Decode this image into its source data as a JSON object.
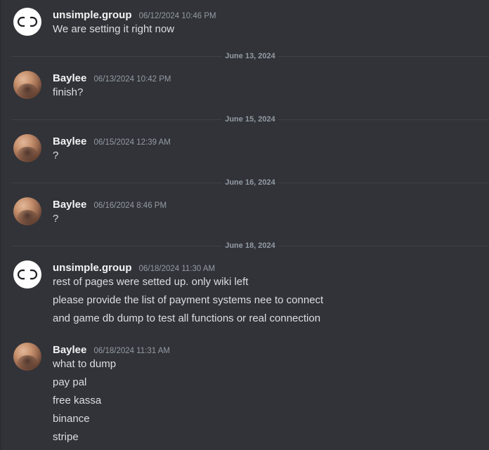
{
  "messages": [
    {
      "author": "unsimple.group",
      "timestamp": "06/12/2024 10:46 PM",
      "lines": [
        "We are setting it right now"
      ]
    },
    {
      "author": "Baylee",
      "timestamp": "06/13/2024 10:42 PM",
      "lines": [
        "finish?"
      ]
    },
    {
      "author": "Baylee",
      "timestamp": "06/15/2024 12:39 AM",
      "lines": [
        "?"
      ]
    },
    {
      "author": "Baylee",
      "timestamp": "06/16/2024 8:46 PM",
      "lines": [
        "?"
      ]
    },
    {
      "author": "unsimple.group",
      "timestamp": "06/18/2024 11:30 AM",
      "lines": [
        "rest of pages were setted up. only wiki left",
        "please provide the list of payment systems nee to connect",
        "and game db dump to test all functions or real connection"
      ]
    },
    {
      "author": "Baylee",
      "timestamp": "06/18/2024 11:31 AM",
      "lines": [
        "what to dump",
        "pay pal",
        "free kassa",
        "binance",
        "stripe"
      ]
    }
  ],
  "dividers": [
    "June 13, 2024",
    "June 15, 2024",
    "June 16, 2024",
    "June 18, 2024"
  ]
}
